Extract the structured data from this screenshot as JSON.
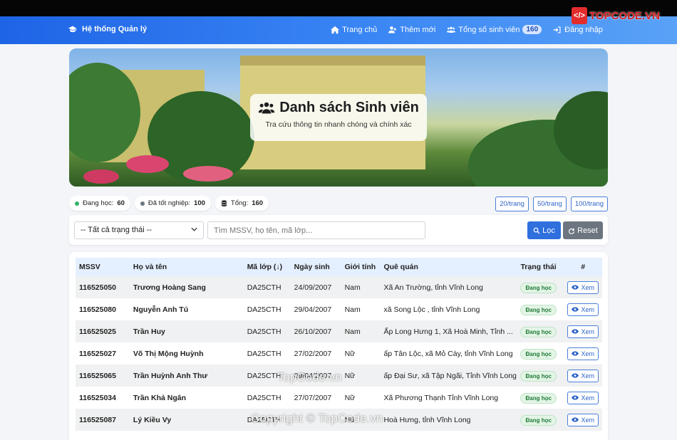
{
  "navbar": {
    "brand": "Hệ thống Quản lý",
    "items": [
      {
        "label": "Trang chủ"
      },
      {
        "label": "Thêm mới"
      },
      {
        "label": "Tổng số sinh viên",
        "badge": "160"
      },
      {
        "label": "Đăng nhập"
      }
    ]
  },
  "watermark": {
    "logo_text": "TOPCODE.VN",
    "center": "TopCode.vn",
    "copyright": "Copyright © TopCode.vn"
  },
  "hero": {
    "title": "Danh sách Sinh viên",
    "subtitle": "Tra cứu thông tin nhanh chóng và chính xác"
  },
  "stats": [
    {
      "label": "Đang học:",
      "value": "60",
      "color": "#2fb36a"
    },
    {
      "label": "Đã tốt nghiệp:",
      "value": "100",
      "color": "#6c7580"
    },
    {
      "label": "Tổng:",
      "value": "160"
    }
  ],
  "per_page": [
    "20/trang",
    "50/trang",
    "100/trang"
  ],
  "filter": {
    "select_value": "-- Tất cả trạng thái --",
    "search_placeholder": "Tìm MSSV, họ tên, mã lớp...",
    "filter_label": "Lọc",
    "reset_label": "Reset"
  },
  "table": {
    "headers": [
      "MSSV",
      "Họ và tên",
      "Mã lớp (↓)",
      "Ngày sinh",
      "Giới tính",
      "Quê quán",
      "Trạng thái",
      "#"
    ],
    "view_label": "Xem",
    "rows": [
      {
        "mssv": "116525050",
        "name": "Trương Hoàng Sang",
        "class": "DA25CTH",
        "dob": "24/09/2007",
        "gender": "Nam",
        "home": "Xã An Trường, tỉnh Vĩnh Long",
        "status": "Đang học"
      },
      {
        "mssv": "116525080",
        "name": "Nguyễn Anh Tú",
        "class": "DA25CTH",
        "dob": "29/04/2007",
        "gender": "Nam",
        "home": "xã Song Lộc , tỉnh Vĩnh Long",
        "status": "Đang học"
      },
      {
        "mssv": "116525025",
        "name": "Trần Huy",
        "class": "DA25CTH",
        "dob": "26/10/2007",
        "gender": "Nam",
        "home": "Ấp Long Hưng 1, Xã Hoà Minh, Tỉnh ...",
        "status": "Đang học"
      },
      {
        "mssv": "116525027",
        "name": "Võ Thị Mộng Huỳnh",
        "class": "DA25CTH",
        "dob": "27/02/2007",
        "gender": "Nữ",
        "home": "ấp Tân Lộc, xã Mỏ Cày, tỉnh Vĩnh Long",
        "status": "Đang học"
      },
      {
        "mssv": "116525065",
        "name": "Trần Huỳnh Anh Thư",
        "class": "DA25CTH",
        "dob": "09/04/2007",
        "gender": "Nữ",
        "home": "ấp Đại Sư, xã Tập Ngãi, Tỉnh Vĩnh Long",
        "status": "Đang học"
      },
      {
        "mssv": "116525034",
        "name": "Trần Khả Ngân",
        "class": "DA25CTH",
        "dob": "27/07/2007",
        "gender": "Nữ",
        "home": "Xã Phương Thạnh Tỉnh Vĩnh Long",
        "status": "Đang học"
      },
      {
        "mssv": "116525087",
        "name": "Lý Kiều Vy",
        "class": "DA25CTH",
        "dob": "",
        "gender": "Nữ",
        "home": "Hoà Hưng, tỉnh Vĩnh Long",
        "status": "Đang học"
      }
    ]
  }
}
